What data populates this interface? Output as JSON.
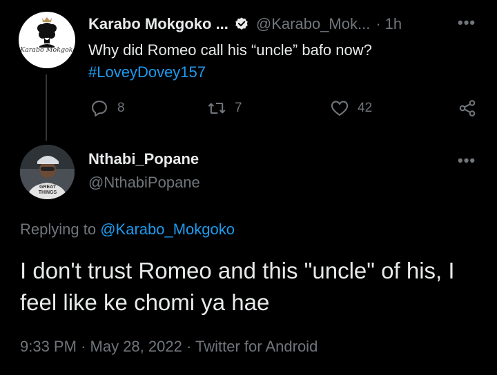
{
  "parent_tweet": {
    "avatar_text": "Karabo Mokgoko",
    "display_name": "Karabo Mokgoko ...",
    "handle": "@Karabo_Mok...",
    "separator": "·",
    "time": "1h",
    "text": "Why did Romeo call his “uncle” bafo now?",
    "hashtag": "#LoveyDovey157",
    "replies": "8",
    "retweets": "7",
    "likes": "42"
  },
  "reply_tweet": {
    "avatar_text": "GREAT THINGS",
    "display_name": "Nthabi_Popane",
    "handle": "@NthabiPopane",
    "replying_prefix": "Replying to",
    "replying_to": "@Karabo_Mokgoko",
    "text": "I don't trust Romeo and this \"uncle\" of his, I feel like ke chomi ya hae",
    "time": "9:33 PM",
    "date": "May 28, 2022",
    "source": "Twitter for Android",
    "meta_sep": "·"
  },
  "icons": {
    "more": "•••"
  },
  "colors": {
    "background": "#000000",
    "text": "#e7e9ea",
    "muted": "#71767b",
    "link": "#1d9bf0"
  }
}
